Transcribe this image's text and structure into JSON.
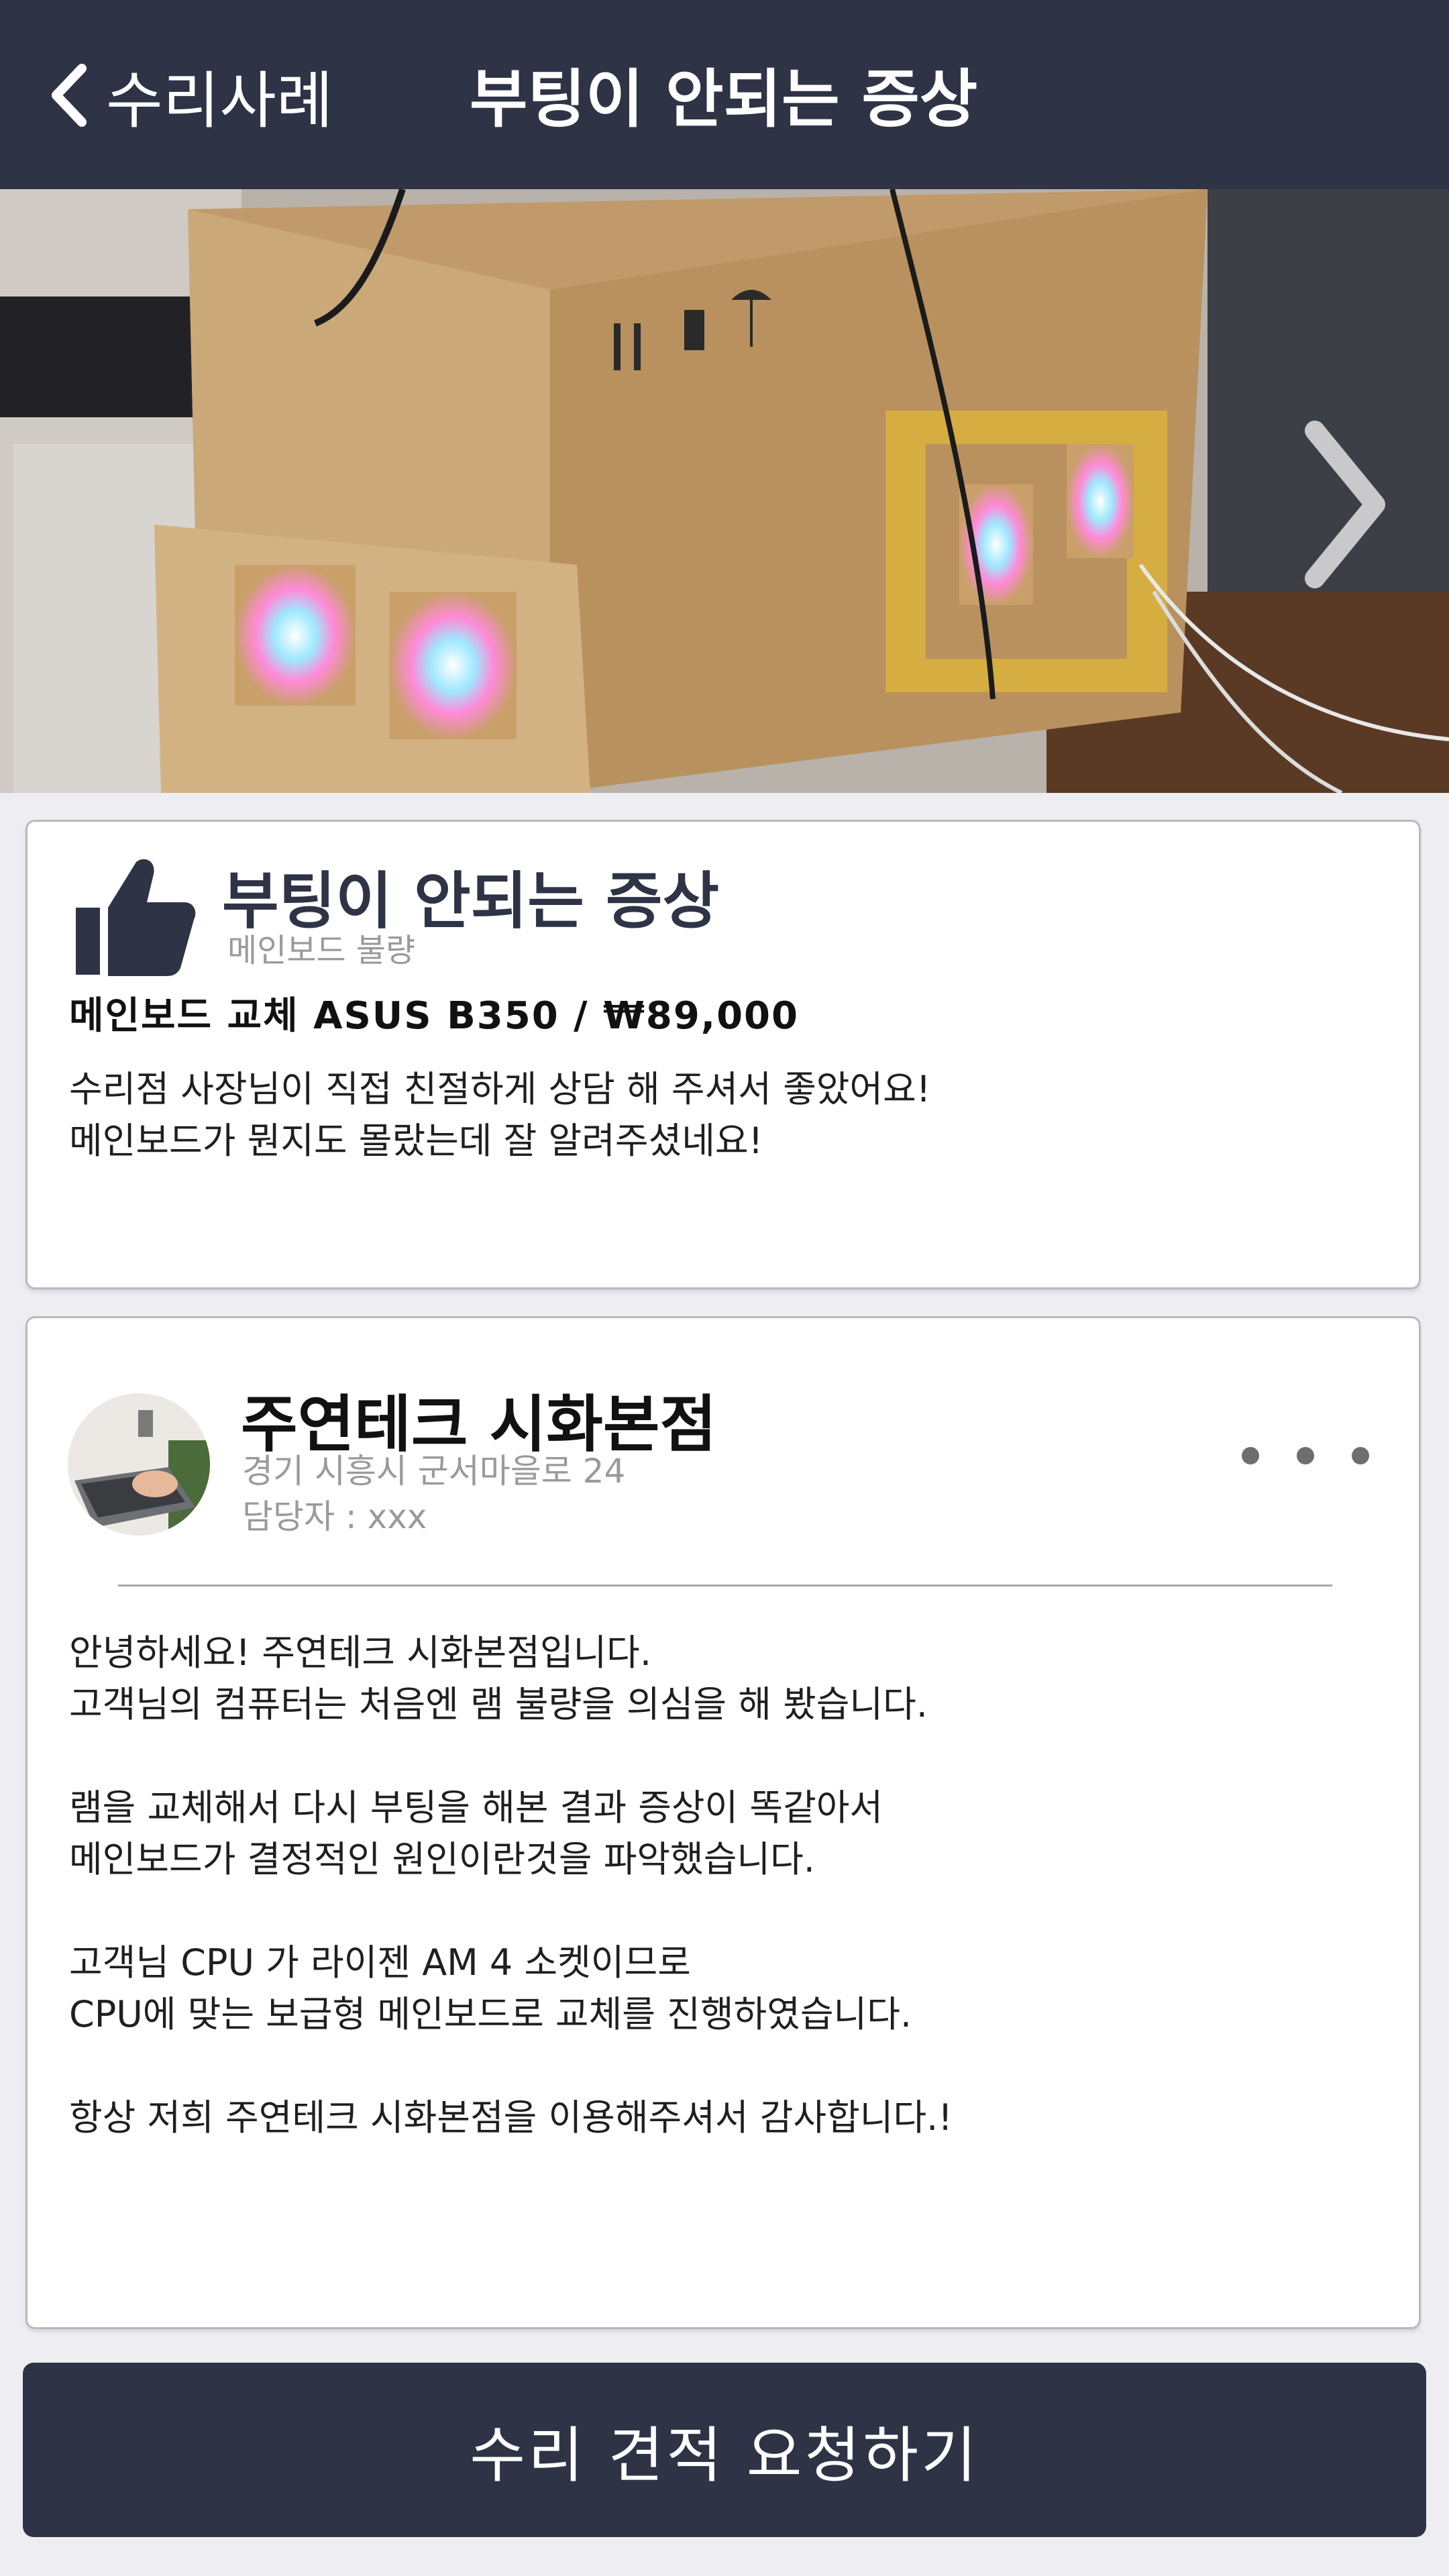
{
  "header": {
    "back_label": "수리사례",
    "title": "부팅이 안되는 증상"
  },
  "review": {
    "title": "부팅이 안되는 증상",
    "category": "메인보드 불량",
    "price_line": "메인보드 교체 ASUS B350 / ₩89,000",
    "text": "수리점 사장님이 직접 친절하게 상담 해 주셔서 좋았어요!\n메인보드가 뭔지도 몰랐는데 잘 알려주셨네요!"
  },
  "shop": {
    "name": "주연테크 시화본점",
    "address": "경기 시흥시 군서마을로 24",
    "manager": "담당자 : xxx",
    "reply": "안녕하세요! 주연테크 시화본점입니다.\n고객님의 컴퓨터는 처음엔 램 불량을 의심을 해 봤습니다.\n\n램을 교체해서 다시 부팅을 해본 결과 증상이 똑같아서\n메인보드가 결정적인 원인이란것을 파악했습니다.\n\n고객님 CPU 가 라이젠 AM 4 소켓이므로\nCPU에 맞는 보급형 메인보드로 교체를 진행하였습니다.\n\n항상 저희 주연테크 시화본점을 이용해주셔서 감사합니다.!"
  },
  "cta": {
    "label": "수리 견적 요청하기"
  },
  "colors": {
    "header_bg": "#2e3446",
    "accent": "#2e3446",
    "muted_text": "#9a9a9a"
  }
}
